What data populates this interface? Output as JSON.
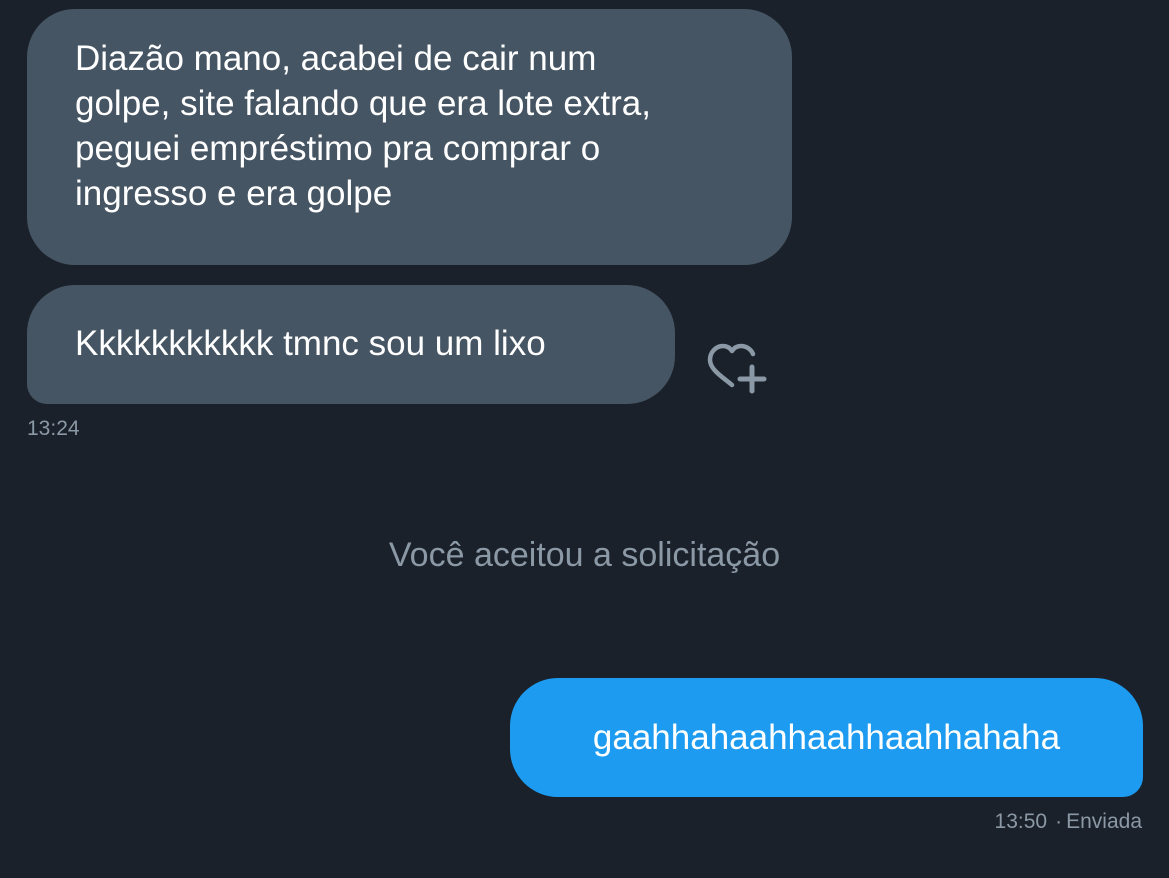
{
  "conversation": {
    "incoming": {
      "message1_lines": [
        "Diazão mano, acabei de cair num",
        "golpe, site falando que era lote extra,",
        "peguei empréstimo pra comprar o",
        "ingresso e era golpe"
      ],
      "message2": "Kkkkkkkkkkk tmnc sou um lixo",
      "timestamp": "13:24",
      "reaction_icon": "heart-plus-icon"
    },
    "system_notice": "Você aceitou a solicitação",
    "outgoing": {
      "message": "gaahhahaahhaahhaahhahaha",
      "timestamp": "13:50",
      "separator": "·",
      "status": "Enviada"
    }
  },
  "colors": {
    "background": "#1a212a",
    "incoming_bubble": "#465563",
    "outgoing_bubble": "#1d9bf0",
    "muted_text": "#8b98a5"
  }
}
